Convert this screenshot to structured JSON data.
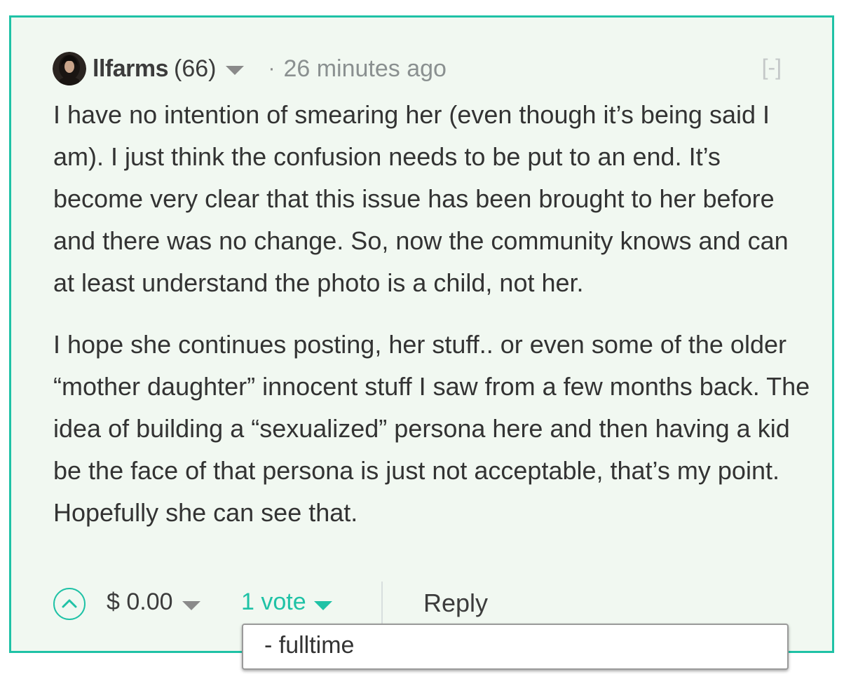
{
  "comment": {
    "author": "llfarms",
    "reputation": "(66)",
    "separator": "·",
    "timestamp": "26 minutes ago",
    "collapse_label": "[-]",
    "paragraphs": [
      "I have no intention of smearing her (even though it’s being said I am). I just think the confusion needs to be put to an end. It’s become very clear that this issue has been brought to her before and there was no change. So, now the community knows and can at least understand the photo is a child, not her.",
      "I hope she continues posting, her stuff.. or even some of the older “mother daughter” innocent stuff I saw from a few months back. The idea of building a “sexualized” persona here and then having a kid be the face of that persona is just not acceptable, that’s my point. Hopefully she can see that."
    ]
  },
  "footer": {
    "payout": "$ 0.00",
    "votes": "1 vote",
    "reply_label": "Reply"
  },
  "voters_dropdown": {
    "items": [
      "- fulltime"
    ]
  },
  "colors": {
    "accent": "#1fc2a6",
    "background": "#f1f8f1",
    "text": "#333333",
    "muted": "#8a9090"
  },
  "icons": [
    "avatar",
    "caret-down-icon",
    "upvote-chevron-icon"
  ]
}
